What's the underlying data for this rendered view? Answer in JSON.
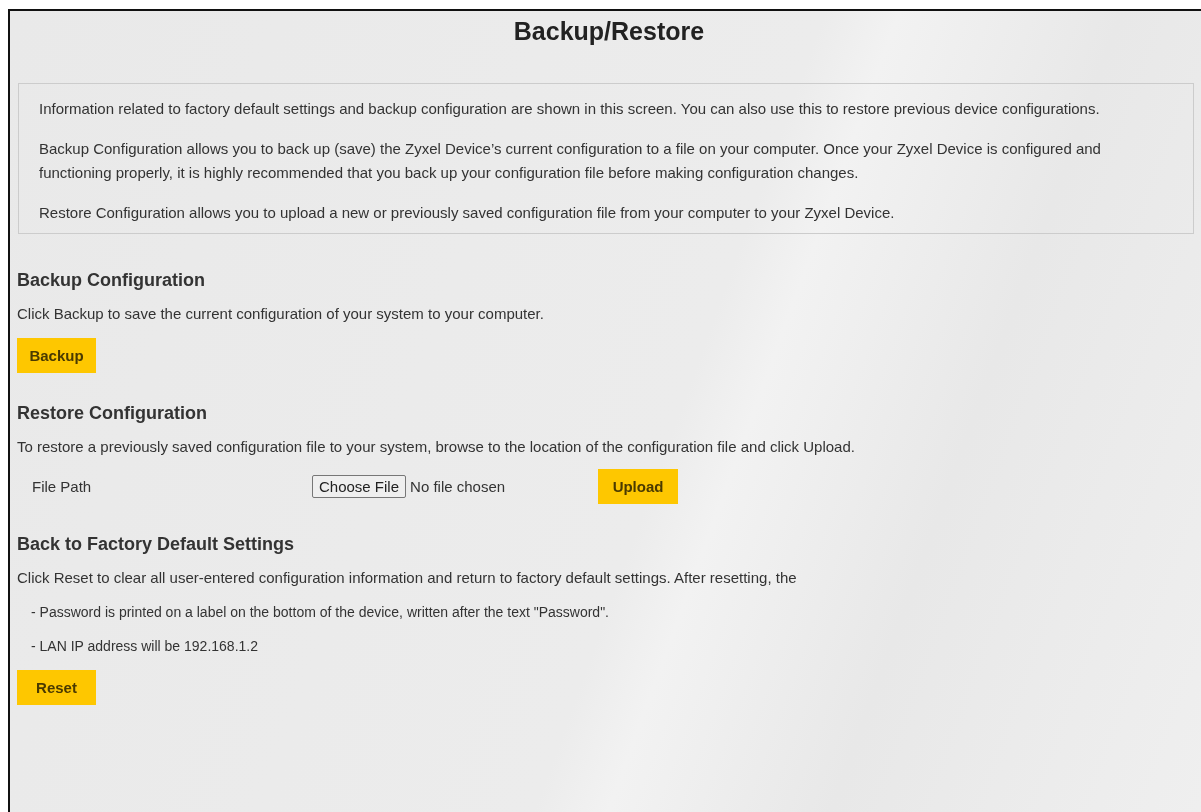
{
  "title": "Backup/Restore",
  "intro": [
    "Information related to factory default settings and backup configuration are shown in this screen. You can also use this to restore previous device configurations.",
    "Backup Configuration allows you to back up (save) the Zyxel Device’s current configuration to a file on your computer. Once your Zyxel Device is configured and functioning properly, it is highly recommended that you back up your configuration file before making configuration changes.",
    "Restore Configuration allows you to upload a new or previously saved configuration file from your computer to your Zyxel Device."
  ],
  "sections": [
    {
      "heading": "Backup Configuration",
      "description": "Click Backup to save the current configuration of your system to your computer.",
      "button": "Backup"
    },
    {
      "heading": "Restore Configuration",
      "description": "To restore a previously saved configuration file to your system, browse to the location of the configuration file and click Upload.",
      "file_row": {
        "label": "File Path",
        "choose_button": "Choose File",
        "status": "No file chosen",
        "button": "Upload"
      }
    },
    {
      "heading": "Back to Factory Default Settings",
      "description": "Click Reset to clear all user-entered configuration information and return to factory default settings. After resetting, the",
      "notes": [
        "- Password is printed on a label on the bottom of the device, written after the text \"Password\".",
        "- LAN IP address will be 192.168.1.2"
      ],
      "button": "Reset"
    }
  ]
}
